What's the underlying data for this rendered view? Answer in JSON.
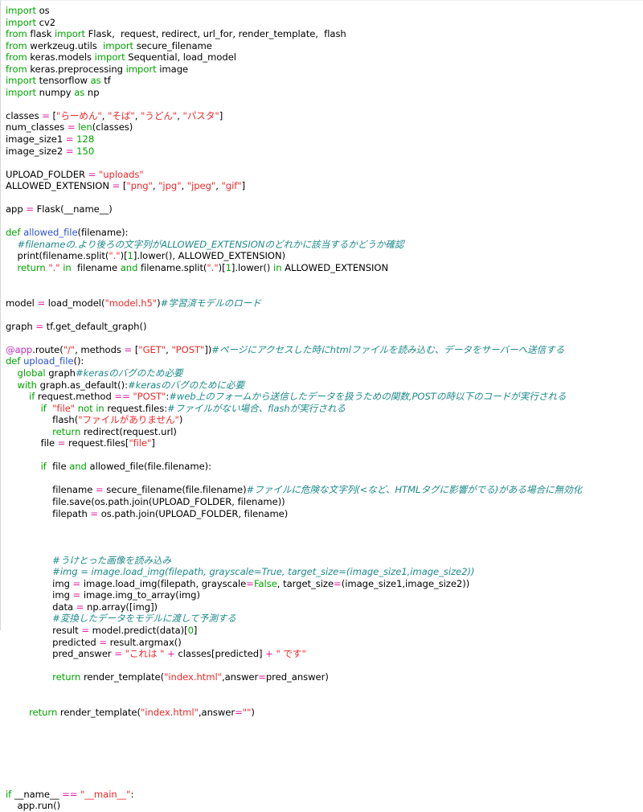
{
  "document": {
    "kind": "source-code-listing",
    "language": "Python",
    "theme": {
      "background": "#ffffff",
      "plain_text": "#000000",
      "keyword": "#00a400",
      "string": "#ef2929",
      "comment": "#1f8a8a",
      "function_name": "#2a54d0",
      "number": "#00a400",
      "builtin": "#00a400",
      "operator": "#e020a0",
      "decorator": "#c030c0"
    }
  },
  "code": {
    "lines": [
      [
        {
          "t": "import",
          "c": "kw"
        },
        {
          "t": " os",
          "c": "pl"
        }
      ],
      [
        {
          "t": "import",
          "c": "kw"
        },
        {
          "t": " cv2",
          "c": "pl"
        }
      ],
      [
        {
          "t": "from",
          "c": "kw"
        },
        {
          "t": " flask ",
          "c": "pl"
        },
        {
          "t": "import",
          "c": "kw"
        },
        {
          "t": " Flask,  request, redirect, url_for, render_template,  flash",
          "c": "pl"
        }
      ],
      [
        {
          "t": "from",
          "c": "kw"
        },
        {
          "t": " werkzeug.utils  ",
          "c": "pl"
        },
        {
          "t": "import",
          "c": "kw"
        },
        {
          "t": " secure_filename",
          "c": "pl"
        }
      ],
      [
        {
          "t": "from",
          "c": "kw"
        },
        {
          "t": " keras.models ",
          "c": "pl"
        },
        {
          "t": "import",
          "c": "kw"
        },
        {
          "t": " Sequential, load_model",
          "c": "pl"
        }
      ],
      [
        {
          "t": "from",
          "c": "kw"
        },
        {
          "t": " keras.preprocessing ",
          "c": "pl"
        },
        {
          "t": "import",
          "c": "kw"
        },
        {
          "t": " image",
          "c": "pl"
        }
      ],
      [
        {
          "t": "import",
          "c": "kw"
        },
        {
          "t": " tensorflow ",
          "c": "pl"
        },
        {
          "t": "as",
          "c": "kw"
        },
        {
          "t": " tf",
          "c": "pl"
        }
      ],
      [
        {
          "t": "import",
          "c": "kw"
        },
        {
          "t": " numpy ",
          "c": "pl"
        },
        {
          "t": "as",
          "c": "kw"
        },
        {
          "t": " np",
          "c": "pl"
        }
      ],
      [],
      [
        {
          "t": "classes ",
          "c": "pl"
        },
        {
          "t": "=",
          "c": "op"
        },
        {
          "t": " [",
          "c": "pl"
        },
        {
          "t": "\"らーめん\"",
          "c": "str"
        },
        {
          "t": ", ",
          "c": "pl"
        },
        {
          "t": "\"そば\"",
          "c": "str"
        },
        {
          "t": ", ",
          "c": "pl"
        },
        {
          "t": "\"うどん\"",
          "c": "str"
        },
        {
          "t": ", ",
          "c": "pl"
        },
        {
          "t": "\"パスタ\"",
          "c": "str"
        },
        {
          "t": "]",
          "c": "pl"
        }
      ],
      [
        {
          "t": "num_classes ",
          "c": "pl"
        },
        {
          "t": "=",
          "c": "op"
        },
        {
          "t": " ",
          "c": "pl"
        },
        {
          "t": "len",
          "c": "bi"
        },
        {
          "t": "(classes)",
          "c": "pl"
        }
      ],
      [
        {
          "t": "image_size1 ",
          "c": "pl"
        },
        {
          "t": "=",
          "c": "op"
        },
        {
          "t": " ",
          "c": "pl"
        },
        {
          "t": "128",
          "c": "num"
        }
      ],
      [
        {
          "t": "image_size2 ",
          "c": "pl"
        },
        {
          "t": "=",
          "c": "op"
        },
        {
          "t": " ",
          "c": "pl"
        },
        {
          "t": "150",
          "c": "num"
        }
      ],
      [],
      [
        {
          "t": "UPLOAD_FOLDER ",
          "c": "pl"
        },
        {
          "t": "=",
          "c": "op"
        },
        {
          "t": " ",
          "c": "pl"
        },
        {
          "t": "\"uploads\"",
          "c": "str"
        }
      ],
      [
        {
          "t": "ALLOWED_EXTENSION ",
          "c": "pl"
        },
        {
          "t": "=",
          "c": "op"
        },
        {
          "t": " [",
          "c": "pl"
        },
        {
          "t": "\"png\"",
          "c": "str"
        },
        {
          "t": ", ",
          "c": "pl"
        },
        {
          "t": "\"jpg\"",
          "c": "str"
        },
        {
          "t": ", ",
          "c": "pl"
        },
        {
          "t": "\"jpeg\"",
          "c": "str"
        },
        {
          "t": ", ",
          "c": "pl"
        },
        {
          "t": "\"gif\"",
          "c": "str"
        },
        {
          "t": "]",
          "c": "pl"
        }
      ],
      [],
      [
        {
          "t": "app ",
          "c": "pl"
        },
        {
          "t": "=",
          "c": "op"
        },
        {
          "t": " Flask(__name__)",
          "c": "pl"
        }
      ],
      [],
      [
        {
          "t": "def",
          "c": "kw"
        },
        {
          "t": " ",
          "c": "pl"
        },
        {
          "t": "allowed_file",
          "c": "fn"
        },
        {
          "t": "(filename):",
          "c": "pl"
        }
      ],
      [
        {
          "t": "    ",
          "c": "pl"
        },
        {
          "t": "#filenameの.より後ろの文字列がALLOWED_EXTENSIONのどれかに該当するかどうか確認",
          "c": "cmt"
        }
      ],
      [
        {
          "t": "    print(filename.split(",
          "c": "pl"
        },
        {
          "t": "\".\"",
          "c": "str"
        },
        {
          "t": ")[",
          "c": "pl"
        },
        {
          "t": "1",
          "c": "num"
        },
        {
          "t": "].lower(), ALLOWED_EXTENSION)",
          "c": "pl"
        }
      ],
      [
        {
          "t": "    ",
          "c": "pl"
        },
        {
          "t": "return",
          "c": "kw"
        },
        {
          "t": " ",
          "c": "pl"
        },
        {
          "t": "\".\"",
          "c": "str"
        },
        {
          "t": " ",
          "c": "pl"
        },
        {
          "t": "in",
          "c": "kw"
        },
        {
          "t": "  filename ",
          "c": "pl"
        },
        {
          "t": "and",
          "c": "kw"
        },
        {
          "t": " filename.split(",
          "c": "pl"
        },
        {
          "t": "\".\"",
          "c": "str"
        },
        {
          "t": ")[",
          "c": "pl"
        },
        {
          "t": "1",
          "c": "num"
        },
        {
          "t": "].lower() ",
          "c": "pl"
        },
        {
          "t": "in",
          "c": "kw"
        },
        {
          "t": " ALLOWED_EXTENSION",
          "c": "pl"
        }
      ],
      [],
      [],
      [
        {
          "t": "model ",
          "c": "pl"
        },
        {
          "t": "=",
          "c": "op"
        },
        {
          "t": " load_model(",
          "c": "pl"
        },
        {
          "t": "\"model.h5\"",
          "c": "str"
        },
        {
          "t": ")",
          "c": "pl"
        },
        {
          "t": "#学習済モデルのロード",
          "c": "cmt"
        }
      ],
      [],
      [
        {
          "t": "graph ",
          "c": "pl"
        },
        {
          "t": "=",
          "c": "op"
        },
        {
          "t": " tf.get_default_graph()",
          "c": "pl"
        }
      ],
      [],
      [
        {
          "t": "@app",
          "c": "dec"
        },
        {
          "t": ".route(",
          "c": "pl"
        },
        {
          "t": "\"/\"",
          "c": "str"
        },
        {
          "t": ", methods ",
          "c": "pl"
        },
        {
          "t": "=",
          "c": "op"
        },
        {
          "t": " [",
          "c": "pl"
        },
        {
          "t": "\"GET\"",
          "c": "str"
        },
        {
          "t": ", ",
          "c": "pl"
        },
        {
          "t": "\"POST\"",
          "c": "str"
        },
        {
          "t": "])",
          "c": "pl"
        },
        {
          "t": "#ページにアクセスした時にhtmlファイルを読み込む、データをサーバーへ送信する",
          "c": "cmt"
        }
      ],
      [
        {
          "t": "def",
          "c": "kw"
        },
        {
          "t": " ",
          "c": "pl"
        },
        {
          "t": "upload_file",
          "c": "fn"
        },
        {
          "t": "():",
          "c": "pl"
        }
      ],
      [
        {
          "t": "    ",
          "c": "pl"
        },
        {
          "t": "global",
          "c": "kw"
        },
        {
          "t": " graph",
          "c": "pl"
        },
        {
          "t": "#kerasのバグのため必要",
          "c": "cmt"
        }
      ],
      [
        {
          "t": "    ",
          "c": "pl"
        },
        {
          "t": "with",
          "c": "kw"
        },
        {
          "t": " graph.as_default():",
          "c": "pl"
        },
        {
          "t": "#kerasのバグのために必要",
          "c": "cmt"
        }
      ],
      [
        {
          "t": "        ",
          "c": "pl"
        },
        {
          "t": "if",
          "c": "kw"
        },
        {
          "t": " request.method ",
          "c": "pl"
        },
        {
          "t": "==",
          "c": "op"
        },
        {
          "t": " ",
          "c": "pl"
        },
        {
          "t": "\"POST\"",
          "c": "str"
        },
        {
          "t": ":",
          "c": "pl"
        },
        {
          "t": "#web上のフォームから送信したデータを扱うための関数,POSTの時以下のコードが実行される",
          "c": "cmt"
        }
      ],
      [
        {
          "t": "            ",
          "c": "pl"
        },
        {
          "t": "if",
          "c": "kw"
        },
        {
          "t": "  ",
          "c": "pl"
        },
        {
          "t": "\"file\"",
          "c": "str"
        },
        {
          "t": " ",
          "c": "pl"
        },
        {
          "t": "not",
          "c": "kw"
        },
        {
          "t": " ",
          "c": "pl"
        },
        {
          "t": "in",
          "c": "kw"
        },
        {
          "t": " request.files:",
          "c": "pl"
        },
        {
          "t": "#ファイルがない場合、flashが実行される",
          "c": "cmt"
        }
      ],
      [
        {
          "t": "                flash(",
          "c": "pl"
        },
        {
          "t": "\"ファイルがありません\"",
          "c": "str"
        },
        {
          "t": ")",
          "c": "pl"
        }
      ],
      [
        {
          "t": "                ",
          "c": "pl"
        },
        {
          "t": "return",
          "c": "kw"
        },
        {
          "t": " redirect(request.url)",
          "c": "pl"
        }
      ],
      [
        {
          "t": "            file ",
          "c": "pl"
        },
        {
          "t": "=",
          "c": "op"
        },
        {
          "t": " request.files[",
          "c": "pl"
        },
        {
          "t": "\"file\"",
          "c": "str"
        },
        {
          "t": "]",
          "c": "pl"
        }
      ],
      [],
      [
        {
          "t": "            ",
          "c": "pl"
        },
        {
          "t": "if",
          "c": "kw"
        },
        {
          "t": "  file ",
          "c": "pl"
        },
        {
          "t": "and",
          "c": "kw"
        },
        {
          "t": " allowed_file(file.filename):",
          "c": "pl"
        }
      ],
      [],
      [
        {
          "t": "                filename ",
          "c": "pl"
        },
        {
          "t": "=",
          "c": "op"
        },
        {
          "t": " secure_filename(file.filename)",
          "c": "pl"
        },
        {
          "t": "#ファイルに危険な文字列(<など、HTMLタグに影響がでる)がある場合に無効化",
          "c": "cmt"
        }
      ],
      [
        {
          "t": "                file.save(os.path.join(UPLOAD_FOLDER, filename))",
          "c": "pl"
        }
      ],
      [
        {
          "t": "                filepath ",
          "c": "pl"
        },
        {
          "t": "=",
          "c": "op"
        },
        {
          "t": " os.path.join(UPLOAD_FOLDER, filename)",
          "c": "pl"
        }
      ],
      [],
      [],
      [],
      [
        {
          "t": "                ",
          "c": "pl"
        },
        {
          "t": "#うけとった画像を読み込み",
          "c": "cmt"
        }
      ],
      [
        {
          "t": "                ",
          "c": "pl"
        },
        {
          "t": "#img = image.load_img(filepath, grayscale=True, target_size=(image_size1,image_size2))",
          "c": "cmt"
        }
      ],
      [
        {
          "t": "                img ",
          "c": "pl"
        },
        {
          "t": "=",
          "c": "op"
        },
        {
          "t": " image.load_img(filepath, grayscale",
          "c": "pl"
        },
        {
          "t": "=",
          "c": "op"
        },
        {
          "t": "False",
          "c": "kw"
        },
        {
          "t": ", target_size",
          "c": "pl"
        },
        {
          "t": "=",
          "c": "op"
        },
        {
          "t": "(image_size1,image_size2))",
          "c": "pl"
        }
      ],
      [
        {
          "t": "                img ",
          "c": "pl"
        },
        {
          "t": "=",
          "c": "op"
        },
        {
          "t": " image.img_to_array(img)",
          "c": "pl"
        }
      ],
      [
        {
          "t": "                data ",
          "c": "pl"
        },
        {
          "t": "=",
          "c": "op"
        },
        {
          "t": " np.array([img])",
          "c": "pl"
        }
      ],
      [
        {
          "t": "                ",
          "c": "pl"
        },
        {
          "t": "#変換したデータをモデルに渡して予測する",
          "c": "cmt"
        }
      ],
      [
        {
          "t": "                result ",
          "c": "pl"
        },
        {
          "t": "=",
          "c": "op"
        },
        {
          "t": " model.predict(data)[",
          "c": "pl"
        },
        {
          "t": "0",
          "c": "num"
        },
        {
          "t": "]",
          "c": "pl"
        }
      ],
      [
        {
          "t": "                predicted ",
          "c": "pl"
        },
        {
          "t": "=",
          "c": "op"
        },
        {
          "t": " result.argmax()",
          "c": "pl"
        }
      ],
      [
        {
          "t": "                pred_answer ",
          "c": "pl"
        },
        {
          "t": "=",
          "c": "op"
        },
        {
          "t": " ",
          "c": "pl"
        },
        {
          "t": "\"これは \"",
          "c": "str"
        },
        {
          "t": " ",
          "c": "pl"
        },
        {
          "t": "+",
          "c": "op"
        },
        {
          "t": " classes[predicted] ",
          "c": "pl"
        },
        {
          "t": "+",
          "c": "op"
        },
        {
          "t": " ",
          "c": "pl"
        },
        {
          "t": "\" です\"",
          "c": "str"
        }
      ],
      [],
      [
        {
          "t": "                ",
          "c": "pl"
        },
        {
          "t": "return",
          "c": "kw"
        },
        {
          "t": " render_template(",
          "c": "pl"
        },
        {
          "t": "\"index.html\"",
          "c": "str"
        },
        {
          "t": ",answer",
          "c": "pl"
        },
        {
          "t": "=",
          "c": "op"
        },
        {
          "t": "pred_answer)",
          "c": "pl"
        }
      ],
      [],
      [],
      [
        {
          "t": "        ",
          "c": "pl"
        },
        {
          "t": "return",
          "c": "kw"
        },
        {
          "t": " render_template(",
          "c": "pl"
        },
        {
          "t": "\"index.html\"",
          "c": "str"
        },
        {
          "t": ",answer",
          "c": "pl"
        },
        {
          "t": "=",
          "c": "op"
        },
        {
          "t": "\"\"",
          "c": "str"
        },
        {
          "t": ")",
          "c": "pl"
        }
      ],
      [],
      [],
      [],
      [],
      [],
      [],
      [
        {
          "t": "if",
          "c": "kw"
        },
        {
          "t": " __name__ ",
          "c": "pl"
        },
        {
          "t": "==",
          "c": "op"
        },
        {
          "t": " ",
          "c": "pl"
        },
        {
          "t": "\"__main__\"",
          "c": "str"
        },
        {
          "t": ":",
          "c": "pl"
        }
      ],
      [
        {
          "t": "    app.run()",
          "c": "pl"
        }
      ]
    ]
  }
}
